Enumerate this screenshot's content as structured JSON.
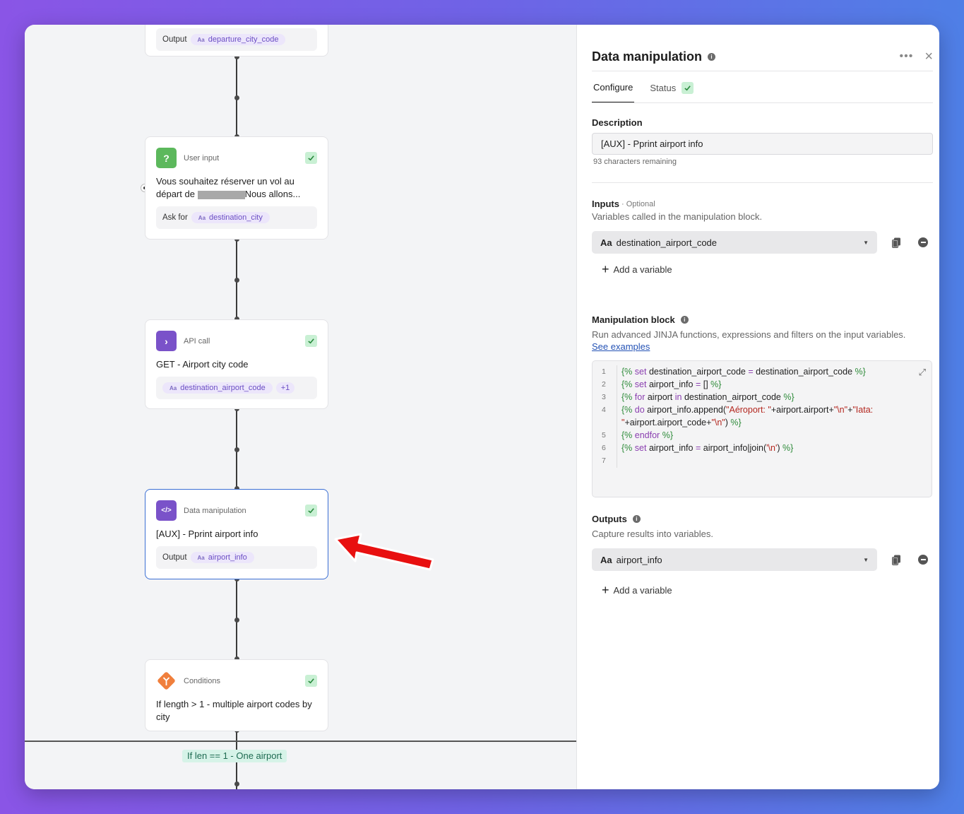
{
  "canvas": {
    "nodes": [
      {
        "output_label": "Output",
        "output_var": "departure_city_code"
      },
      {
        "type": "User input",
        "title_part1": "Vous souhaitez réserver un vol au départ de",
        "title_part2": "Nous allons...",
        "sub_label": "Ask for",
        "sub_var": "destination_city"
      },
      {
        "type": "API call",
        "title": "GET - Airport city code",
        "sub_var": "destination_airport_code",
        "sub_extra": "+1"
      },
      {
        "type": "Data manipulation",
        "title": "[AUX] - Pprint airport info",
        "sub_label": "Output",
        "sub_var": "airport_info"
      },
      {
        "type": "Conditions",
        "title": "If length > 1 - multiple airport codes by city"
      }
    ],
    "branch_label": "If len == 1 - One airport",
    "var_prefix": "Aa",
    "user_input_icon": "?",
    "api_call_icon": "›",
    "data_manipulation_icon": "</>",
    "colors": {
      "user_input": "#5cb85c",
      "api_call": "#7a52c9",
      "data_manipulation": "#7a52c9",
      "conditions": "#f07f3c",
      "selected_border": "#3b6fd4",
      "arrow": "#e81010"
    }
  },
  "panel": {
    "title": "Data manipulation",
    "tabs": {
      "configure": "Configure",
      "status": "Status"
    },
    "description": {
      "label": "Description",
      "value": "[AUX] - Pprint airport info",
      "remaining": "93 characters remaining"
    },
    "inputs": {
      "label": "Inputs",
      "optional": "· Optional",
      "helper": "Variables called in the manipulation block.",
      "variable": "destination_airport_code",
      "add": "Add a variable"
    },
    "manipulation": {
      "label": "Manipulation block",
      "helper": "Run advanced JINJA functions, expressions and filters on the input variables.",
      "link": "See examples",
      "line_numbers": [
        "1",
        "2",
        "3",
        "4",
        "5",
        "6",
        "7"
      ]
    },
    "outputs": {
      "label": "Outputs",
      "helper": "Capture results into variables.",
      "variable": "airport_info",
      "add": "Add a variable"
    },
    "var_prefix": "Aa"
  }
}
